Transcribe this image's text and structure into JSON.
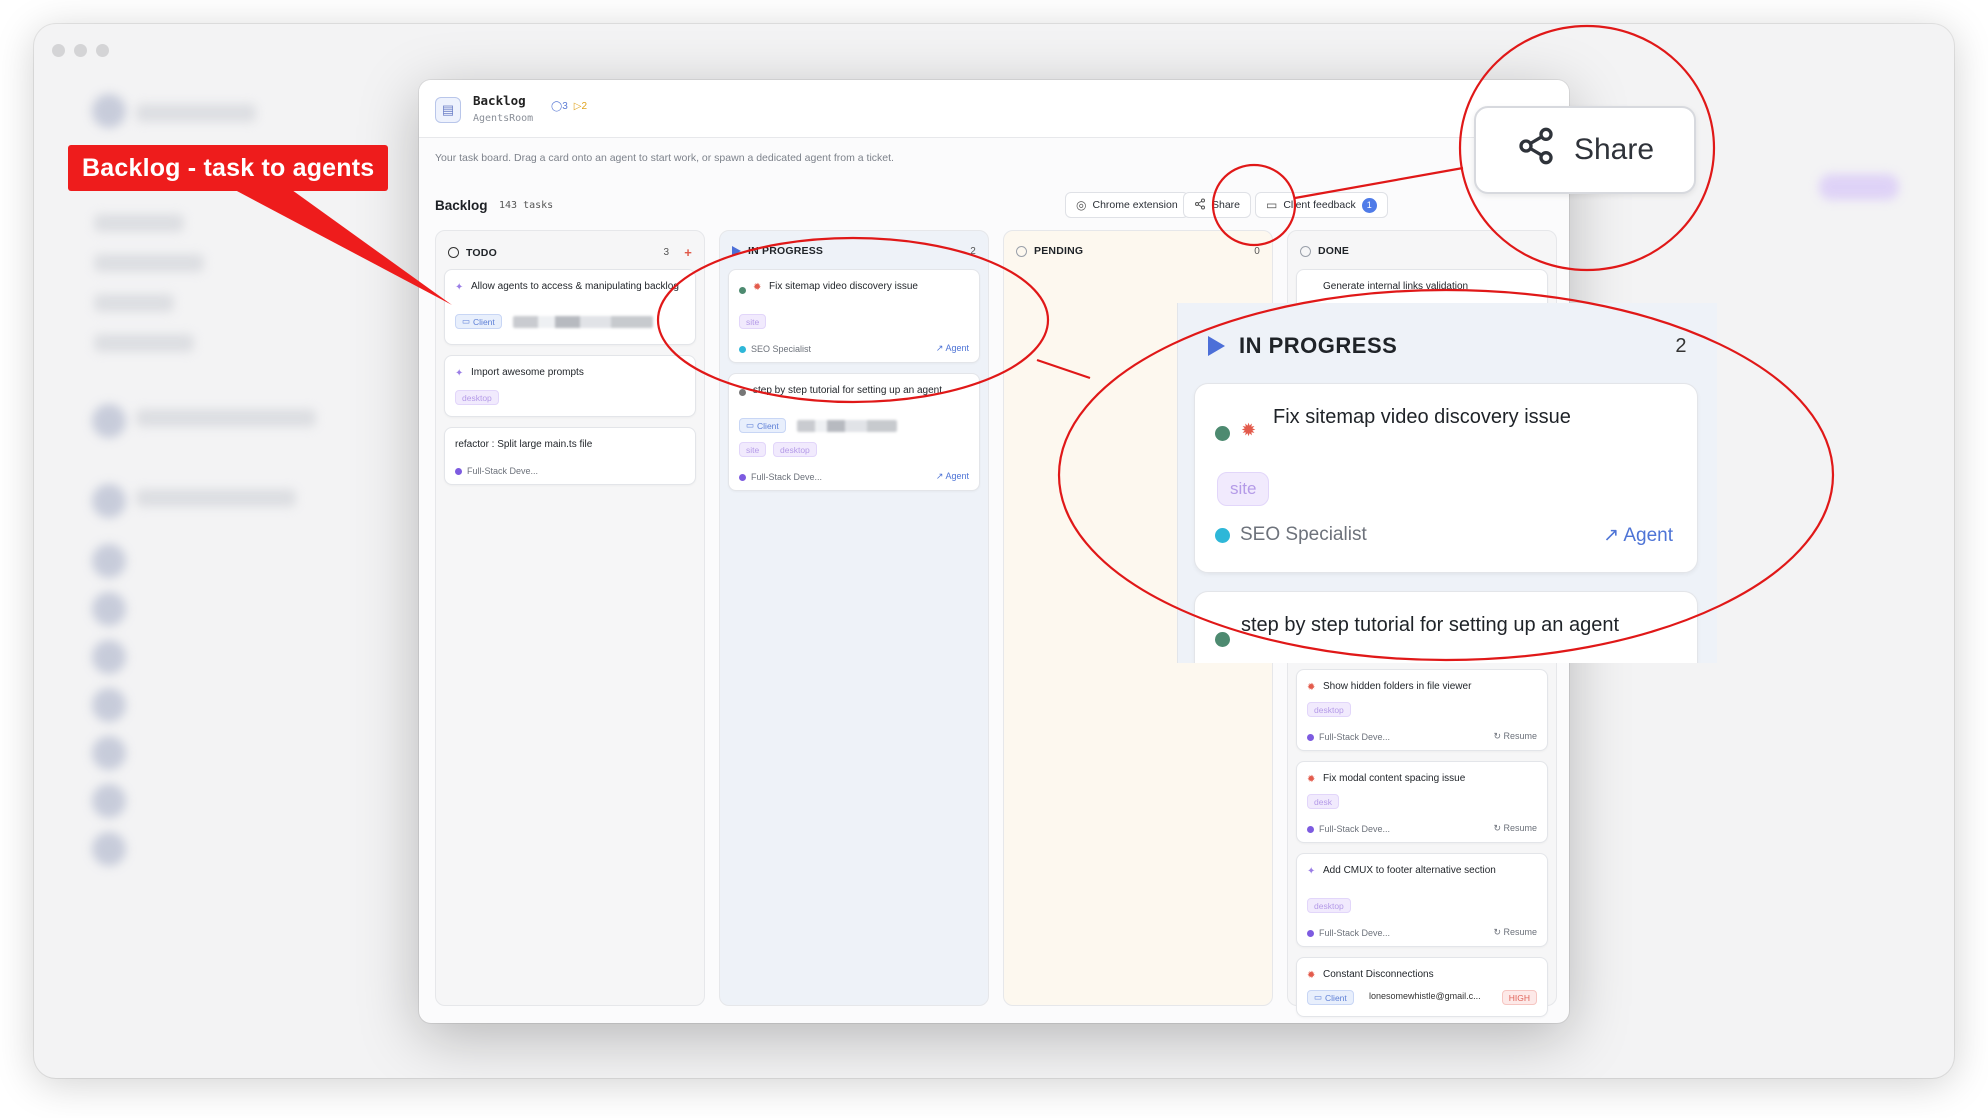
{
  "modal": {
    "title": "Backlog",
    "subtitle": "AgentsRoom",
    "badge_todo": "◯3",
    "badge_prog": "▷2",
    "hint": "Your task board. Drag a card onto an agent to start work, or spawn a dedicated agent from a ticket."
  },
  "toolbar": {
    "title": "Backlog",
    "count": "143 tasks",
    "chrome_extension": "Chrome extension",
    "share": "Share",
    "client_feedback": "Client feedback",
    "feedback_count": "1"
  },
  "columns": {
    "todo": {
      "label": "TODO",
      "count": "3",
      "plus": "+"
    },
    "in_progress": {
      "label": "IN PROGRESS",
      "count": "2"
    },
    "pending": {
      "label": "PENDING",
      "count": "0",
      "plus": "+"
    },
    "done": {
      "label": "DONE"
    }
  },
  "todo_cards": [
    {
      "title": "Allow agents to access & manipulating backlog",
      "tag": "Client"
    },
    {
      "title": "Import awesome prompts",
      "tag": "desktop"
    },
    {
      "title": "refactor : Split large main.ts file",
      "agent": "Full-Stack Deve..."
    }
  ],
  "progress_cards": [
    {
      "title": "Fix sitemap video discovery issue",
      "tag": "site",
      "agent": "SEO Specialist",
      "link": "↗ Agent"
    },
    {
      "title": "step by step tutorial for setting up an agent",
      "tag_client": "Client",
      "tag1": "site",
      "tag2": "desktop",
      "agent": "Full-Stack Deve...",
      "link": "↗ Agent"
    }
  ],
  "done_cards": [
    {
      "title": "Generate internal links validation"
    },
    {
      "title": "Show hidden folders in file viewer",
      "tag": "desktop",
      "agent": "Full-Stack Deve...",
      "resume": "Resume"
    },
    {
      "title": "Fix modal content spacing issue",
      "tag": "desk",
      "agent": "Full-Stack Deve...",
      "resume": "Resume"
    },
    {
      "title": "Add CMUX to footer alternative section",
      "tag": "desktop",
      "agent": "Full-Stack Deve...",
      "resume": "Resume"
    },
    {
      "title": "Constant Disconnections",
      "tag_client": "Client",
      "email": "lonesomewhistle@gmail.c...",
      "priority": "HIGH"
    }
  ],
  "zoom": {
    "label": "IN PROGRESS",
    "count": "2",
    "card1_title": "Fix sitemap video discovery issue",
    "card1_tag": "site",
    "card1_agent": "SEO Specialist",
    "card1_link": "↗ Agent",
    "card2_title": "step by step tutorial for setting up an agent"
  },
  "share_zoom": {
    "label": "Share"
  },
  "annotation": {
    "label": "Backlog - task to agents"
  },
  "icons": [
    "board-icon",
    "chrome-icon",
    "share-icon",
    "chat-icon",
    "sparkle-icon",
    "bug-icon",
    "play-icon",
    "circle-icon"
  ],
  "colors": {
    "annotation_red": "#ee1c1c",
    "accent_blue": "#4c6fd8",
    "tag_purple": "#b59be8"
  }
}
